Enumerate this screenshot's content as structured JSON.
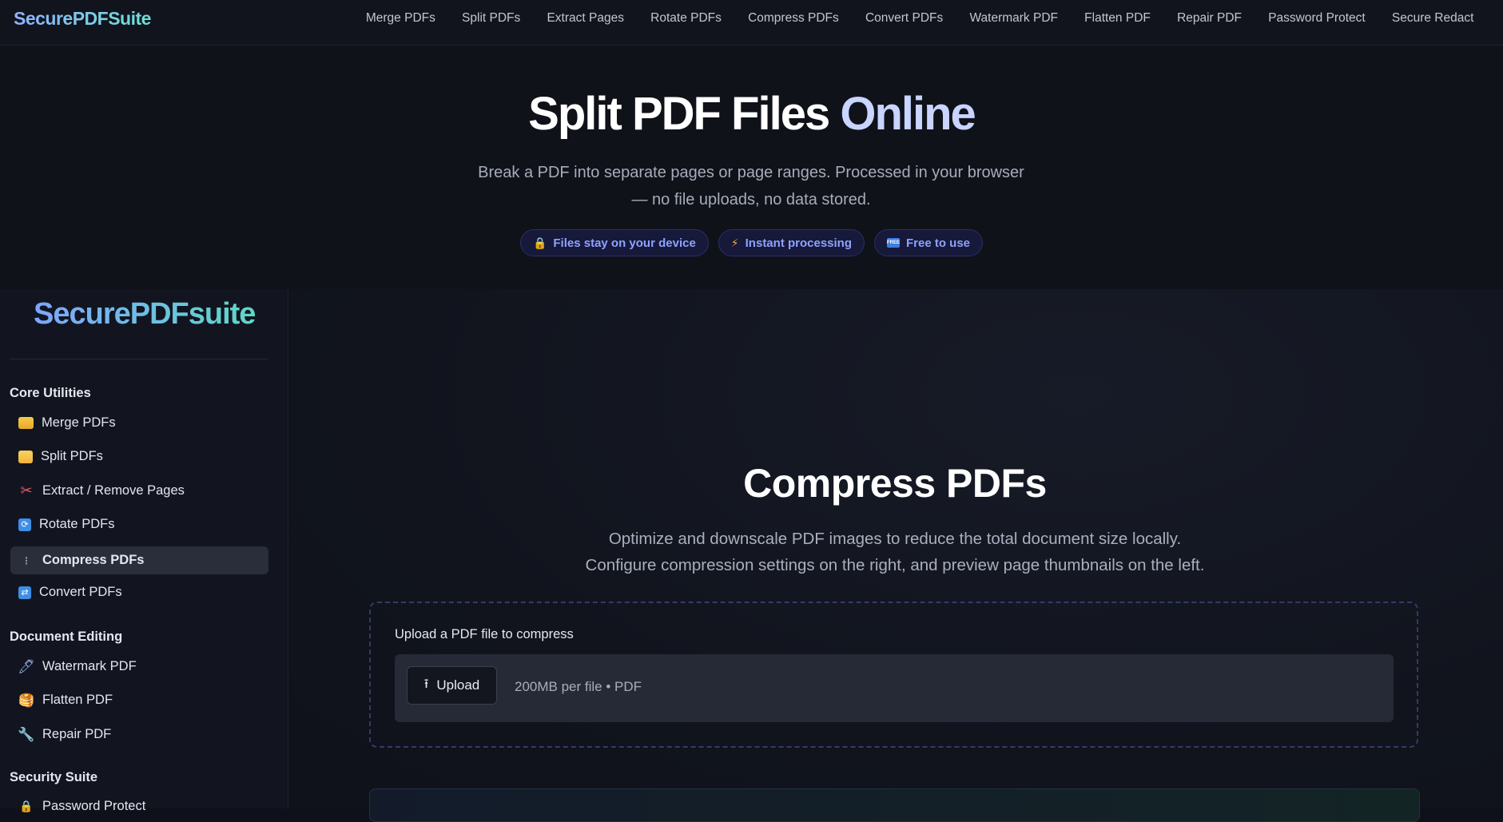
{
  "topbar": {
    "brand": "SecurePDFSuite",
    "nav": [
      "Merge PDFs",
      "Split PDFs",
      "Extract Pages",
      "Rotate PDFs",
      "Compress PDFs",
      "Convert PDFs",
      "Watermark PDF",
      "Flatten PDF",
      "Repair PDF",
      "Password Protect",
      "Secure Redact"
    ]
  },
  "hero": {
    "title_part1": "Split PDF Files",
    "title_part2": "Online",
    "subtitle": "Break a PDF into separate pages or page ranges. Processed in your browser — no file uploads, no data stored.",
    "badges": [
      {
        "icon": "lock-icon",
        "label": "Files stay on your device"
      },
      {
        "icon": "lightning-icon",
        "label": "Instant processing"
      },
      {
        "icon": "free-icon",
        "label": "Free to use"
      }
    ]
  },
  "sidebar": {
    "brand": "SecurePDFsuite",
    "sections": [
      {
        "title": "Core Utilities",
        "items": [
          {
            "label": "Merge PDFs",
            "icon": "folder-icon"
          },
          {
            "label": "Split PDFs",
            "icon": "folder-open-icon"
          },
          {
            "label": "Extract / Remove Pages",
            "icon": "scissors-icon"
          },
          {
            "label": "Rotate PDFs",
            "icon": "rotate-icon"
          },
          {
            "label": "Compress PDFs",
            "icon": "compress-icon",
            "active": true
          },
          {
            "label": "Convert PDFs",
            "icon": "convert-icon"
          }
        ]
      },
      {
        "title": "Document Editing",
        "items": [
          {
            "label": "Watermark PDF",
            "icon": "pen-icon"
          },
          {
            "label": "Flatten PDF",
            "icon": "pancake-icon"
          },
          {
            "label": "Repair PDF",
            "icon": "wrench-icon"
          }
        ]
      },
      {
        "title": "Security Suite",
        "items": [
          {
            "label": "Password Protect",
            "icon": "lock-icon"
          }
        ]
      }
    ]
  },
  "main": {
    "title": "Compress PDFs",
    "description_line1": "Optimize and downscale PDF images to reduce the total document size locally.",
    "description_line2": "Configure compression settings on the right, and preview page thumbnails on the left.",
    "upload_label": "Upload a PDF file to compress",
    "upload_button": "Upload",
    "limit_text": "200MB per file • PDF"
  },
  "colors": {
    "background": "#0e111a",
    "accent": "#8ea2ff",
    "brand_gradient_start": "#8fb2ff",
    "brand_gradient_end": "#6ee0d6"
  }
}
